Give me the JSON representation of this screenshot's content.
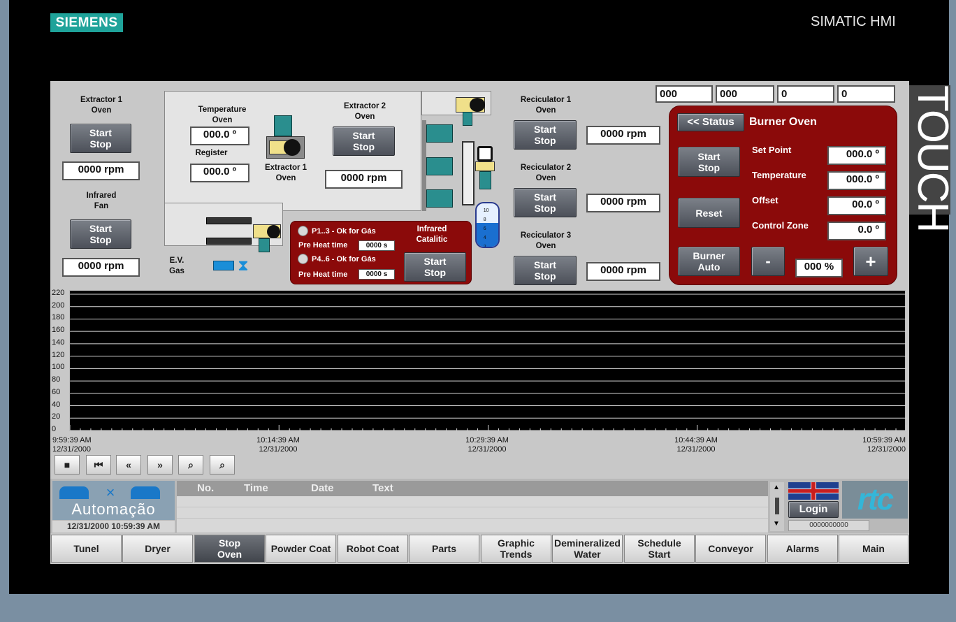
{
  "brand": {
    "siemens": "SIEMENS",
    "product": "SIMATIC HMI",
    "touch": "TOUCH"
  },
  "colors": {
    "panel_red": "#8b0a0a",
    "button_grey": "#5a5e66",
    "motor_teal": "#2a8e8e",
    "siemens_teal": "#1fa39a"
  },
  "top_fields": [
    "000",
    "000",
    "0",
    "0"
  ],
  "extractor1": {
    "title": "Extractor 1\nOven",
    "button": "Start\nStop",
    "rpm": "0000 rpm"
  },
  "infrared_fan": {
    "title": "Infrared\nFan",
    "button": "Start\nStop",
    "rpm": "0000 rpm"
  },
  "temperature": {
    "title": "Temperature\nOven",
    "value": "000.0 º",
    "register_label": "Register",
    "register_value": "000.0 º"
  },
  "extractor1_motor_label": "Extractor 1\nOven",
  "extractor2": {
    "title": "Extractor 2\nOven",
    "button": "Start\nStop",
    "rpm": "0000 rpm"
  },
  "ev_gas": "E.V.\nGas",
  "gauge": {
    "ticks": [
      "10",
      "8",
      "6",
      "4",
      "2"
    ]
  },
  "infrared_catalitic": {
    "p13": "P1..3 - Ok for Gás",
    "p46": "P4..6 - Ok for Gás",
    "preheat_label": "Pre Heat time",
    "preheat1": "0000 s",
    "preheat2": "0000 s",
    "title": "Infrared\nCatalitic",
    "button": "Start\nStop"
  },
  "reciculators": [
    {
      "title": "Reciculator 1\nOven",
      "button": "Start\nStop",
      "rpm": "0000 rpm"
    },
    {
      "title": "Reciculator 2\nOven",
      "button": "Start\nStop",
      "rpm": "0000 rpm"
    },
    {
      "title": "Reciculator 3\nOven",
      "button": "Start\nStop",
      "rpm": "0000 rpm"
    }
  ],
  "burner": {
    "status_button": "<< Status",
    "title": "Burner Oven",
    "start_stop": "Start\nStop",
    "reset": "Reset",
    "auto": "Burner\nAuto",
    "minus": "-",
    "plus": "+",
    "percent": "000 %",
    "setpoint_label": "Set Point",
    "setpoint": "000.0 º",
    "temperature_label": "Temperature",
    "temperature": "000.0 º",
    "offset_label": "Offset",
    "offset": "00.0 º",
    "control_zone_label": "Control Zone",
    "control_zone": "0.0 º"
  },
  "chart_data": {
    "type": "line",
    "yticks": [
      "220",
      "200",
      "180",
      "160",
      "140",
      "120",
      "100",
      "80",
      "60",
      "40",
      "20",
      "0"
    ],
    "ylim": [
      0,
      220
    ],
    "xticks": [
      {
        "time": "9:59:39 AM",
        "date": "12/31/2000"
      },
      {
        "time": "10:14:39 AM",
        "date": "12/31/2000"
      },
      {
        "time": "10:29:39 AM",
        "date": "12/31/2000"
      },
      {
        "time": "10:44:39 AM",
        "date": "12/31/2000"
      },
      {
        "time": "10:59:39 AM",
        "date": "12/31/2000"
      }
    ],
    "grid": true,
    "series": []
  },
  "trend_toolbar": [
    "stop-icon",
    "first-icon",
    "rewind-icon",
    "forward-icon",
    "zoom-in-icon",
    "zoom-out-icon"
  ],
  "logo": {
    "text": "Automação",
    "datetime": "12/31/2000 10:59:39 AM"
  },
  "alarms": {
    "headers": [
      "No.",
      "Time",
      "Date",
      "Text"
    ]
  },
  "user": {
    "login": "Login",
    "counter": "0000000000"
  },
  "rtc_logo": "rtc",
  "nav": [
    "Tunel",
    "Dryer",
    "Stop\nOven",
    "Powder Coat",
    "Robot Coat",
    "Parts",
    "Graphic\nTrends",
    "Demineralized\nWater",
    "Schedule\nStart",
    "Conveyor",
    "Alarms",
    "Main"
  ],
  "nav_selected": 2
}
